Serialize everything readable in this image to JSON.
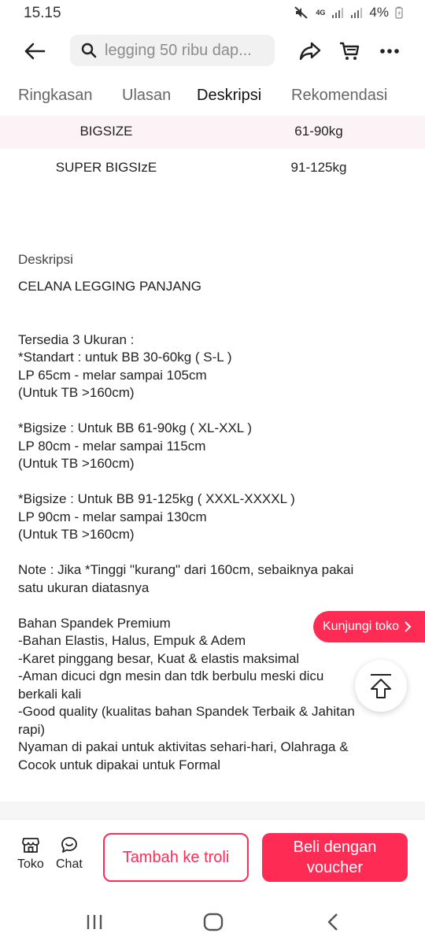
{
  "status_bar": {
    "time": "15.15",
    "network": "4G",
    "battery": "4%"
  },
  "header": {
    "search_placeholder": "legging 50 ribu dap..."
  },
  "tabs": [
    {
      "label": "Ringkasan",
      "active": false
    },
    {
      "label": "Ulasan",
      "active": false
    },
    {
      "label": "Deskripsi",
      "active": true
    },
    {
      "label": "Rekomendasi",
      "active": false
    }
  ],
  "size_table": [
    {
      "size": "BIGSIZE",
      "range": "61-90kg"
    },
    {
      "size": "SUPER BIGSIzE",
      "range": "91-125kg"
    }
  ],
  "description": {
    "heading": "Deskripsi",
    "lines": [
      "CELANA LEGGING PANJANG",
      "",
      "",
      "Tersedia 3 Ukuran :",
      "*Standart : untuk BB 30-60kg ( S-L )",
      "LP 65cm - melar sampai 105cm",
      "(Untuk TB >160cm)",
      "",
      "*Bigsize : Untuk BB 61-90kg ( XL-XXL )",
      "LP 80cm - melar sampai 115cm",
      "(Untuk TB >160cm)",
      "",
      "*Bigsize : Untuk BB 91-125kg ( XXXL-XXXXL )",
      "LP 90cm - melar sampai 130cm",
      "(Untuk TB >160cm)",
      "",
      "Note : Jika *Tinggi \"kurang\" dari 160cm, sebaiknya pakai",
      "satu ukuran diatasnya",
      "",
      "Bahan Spandek Premium",
      "-Bahan Elastis, Halus, Empuk & Adem",
      "-Karet pinggang besar, Kuat & elastis maksimal",
      "-Aman dicuci dgn mesin dan tdk berbulu meski dicu",
      "berkali kali",
      "-Good quality (kualitas bahan Spandek Terbaik & Jahitan",
      "rapi)",
      "Nyaman di pakai untuk aktivitas sehari-hari, Olahraga &",
      "Cocok untuk dipakai untuk Formal"
    ]
  },
  "floating": {
    "visit_store_label": "Kunjungi toko"
  },
  "bottom_bar": {
    "store_label": "Toko",
    "chat_label": "Chat",
    "add_to_cart_label": "Tambah ke troli",
    "buy_label": "Beli dengan voucher"
  },
  "colors": {
    "accent": "#fe2c55",
    "table_row_shade": "#fbf3f6"
  }
}
